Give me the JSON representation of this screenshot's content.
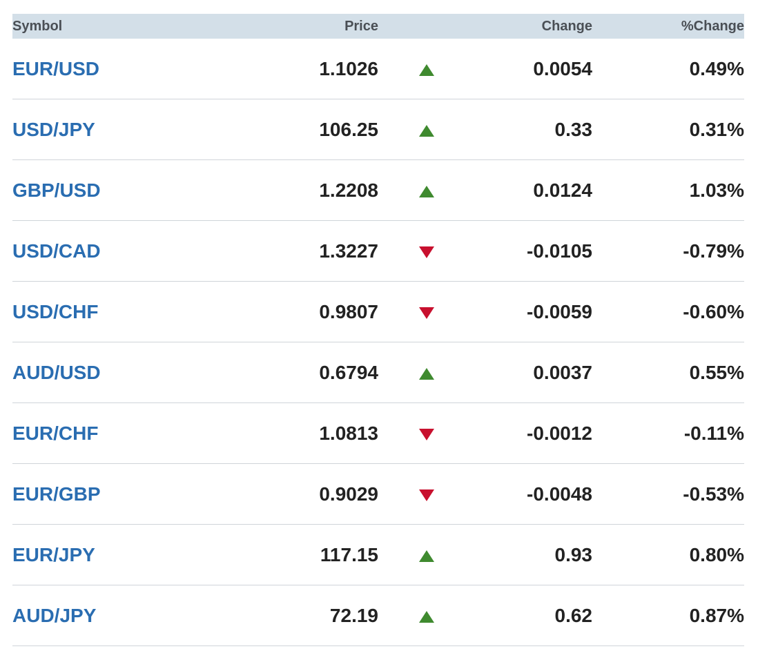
{
  "table": {
    "headers": {
      "symbol": "Symbol",
      "price": "Price",
      "change": "Change",
      "pct_change": "%Change"
    },
    "colors": {
      "symbol_link": "#2a6db1",
      "up": "#3f8a2f",
      "down": "#c8102e",
      "header_bg": "#d3dfe8"
    },
    "rows": [
      {
        "symbol": "EUR/USD",
        "price": "1.1026",
        "direction": "up",
        "change": "0.0054",
        "pct_change": "0.49%"
      },
      {
        "symbol": "USD/JPY",
        "price": "106.25",
        "direction": "up",
        "change": "0.33",
        "pct_change": "0.31%"
      },
      {
        "symbol": "GBP/USD",
        "price": "1.2208",
        "direction": "up",
        "change": "0.0124",
        "pct_change": "1.03%"
      },
      {
        "symbol": "USD/CAD",
        "price": "1.3227",
        "direction": "down",
        "change": "-0.0105",
        "pct_change": "-0.79%"
      },
      {
        "symbol": "USD/CHF",
        "price": "0.9807",
        "direction": "down",
        "change": "-0.0059",
        "pct_change": "-0.60%"
      },
      {
        "symbol": "AUD/USD",
        "price": "0.6794",
        "direction": "up",
        "change": "0.0037",
        "pct_change": "0.55%"
      },
      {
        "symbol": "EUR/CHF",
        "price": "1.0813",
        "direction": "down",
        "change": "-0.0012",
        "pct_change": "-0.11%"
      },
      {
        "symbol": "EUR/GBP",
        "price": "0.9029",
        "direction": "down",
        "change": "-0.0048",
        "pct_change": "-0.53%"
      },
      {
        "symbol": "EUR/JPY",
        "price": "117.15",
        "direction": "up",
        "change": "0.93",
        "pct_change": "0.80%"
      },
      {
        "symbol": "AUD/JPY",
        "price": "72.19",
        "direction": "up",
        "change": "0.62",
        "pct_change": "0.87%"
      }
    ]
  }
}
